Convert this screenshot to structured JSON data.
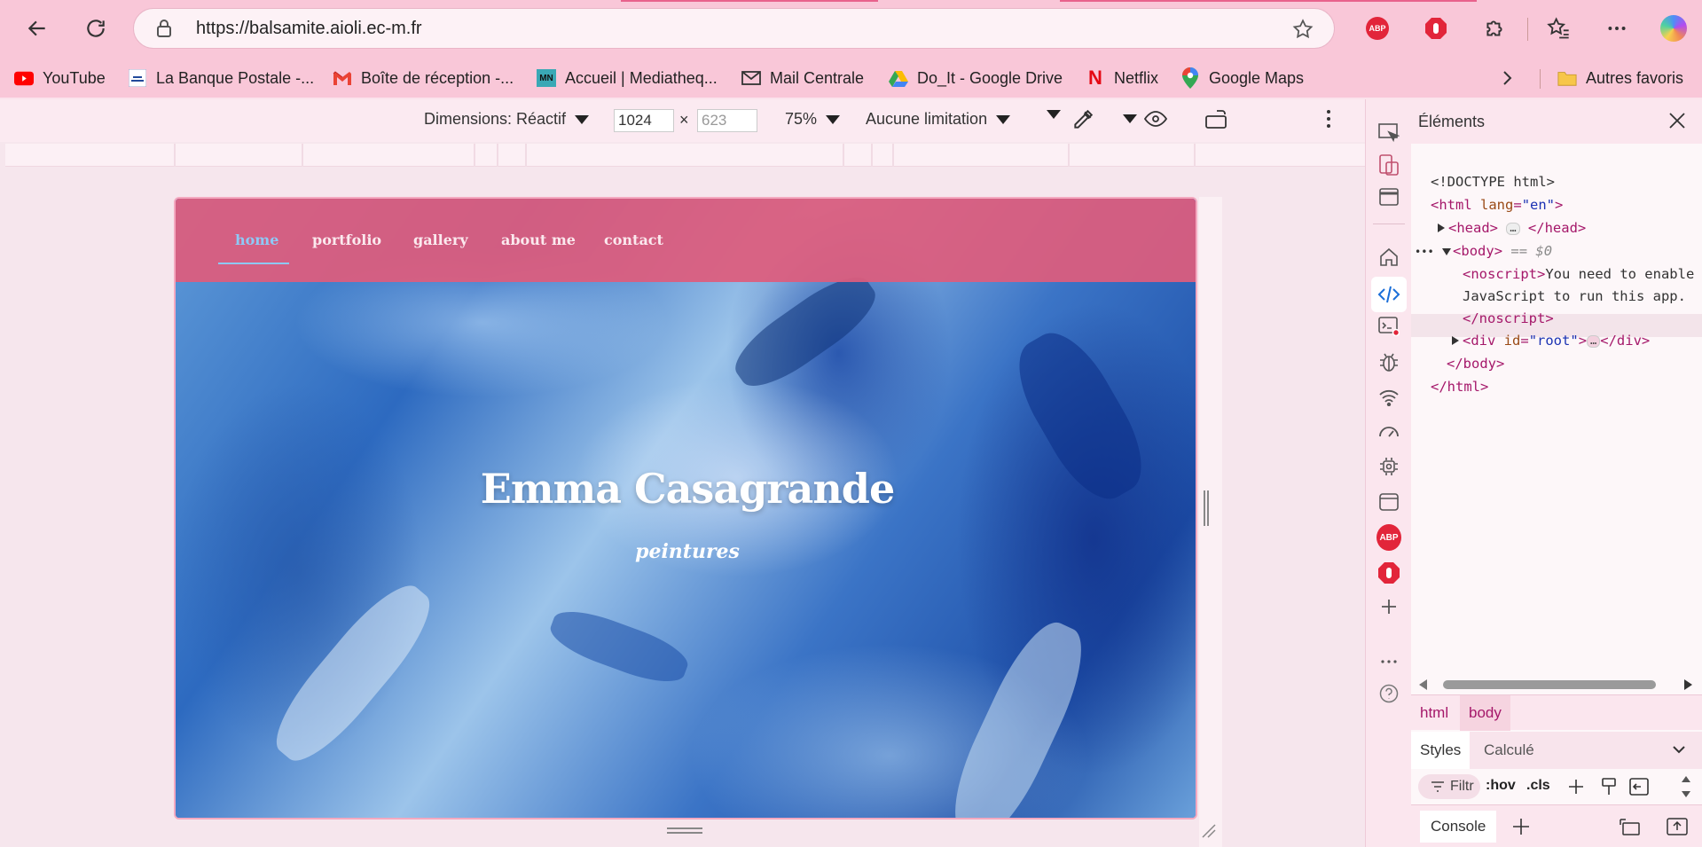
{
  "browser": {
    "url": "https://balsamite.aioli.ec-m.fr",
    "bookmarks": [
      {
        "label": "YouTube",
        "icon": "youtube-icon"
      },
      {
        "label": "La Banque Postale -...",
        "icon": "banque-postale-icon"
      },
      {
        "label": "Boîte de réception -...",
        "icon": "gmail-icon"
      },
      {
        "label": "Accueil | Mediatheq...",
        "icon": "mediatheque-icon",
        "badge": "MN"
      },
      {
        "label": "Mail Centrale",
        "icon": "mail-icon"
      },
      {
        "label": "Do_It - Google Drive",
        "icon": "google-drive-icon"
      },
      {
        "label": "Netflix",
        "icon": "netflix-icon",
        "badge": "N"
      },
      {
        "label": "Google Maps",
        "icon": "google-maps-icon"
      }
    ],
    "other_favorites": "Autres favoris",
    "abp_label": "ABP"
  },
  "emulation": {
    "dimensions_label": "Dimensions: Réactif",
    "width": "1024",
    "separator": "×",
    "height_placeholder": "623",
    "zoom": "75%",
    "throttling": "Aucune limitation"
  },
  "site": {
    "nav": [
      "home",
      "portfolio",
      "gallery",
      "about me",
      "contact"
    ],
    "active_nav": "home",
    "title": "Emma Casagrande",
    "subtitle": "peintures"
  },
  "devtools": {
    "panel_title": "Éléments",
    "dom": {
      "doctype": "<!DOCTYPE html>",
      "html_open_tag": "<html",
      "html_attr": "lang",
      "html_attr_value": "\"en\"",
      "head_open": "<head>",
      "head_close": "</head>",
      "body_open": "<body>",
      "body_marker": "== $0",
      "noscript_open": "<noscript>",
      "noscript_text_1": "You need to enable",
      "noscript_text_2": "JavaScript to run this app.",
      "noscript_close": "</noscript>",
      "div_open": "<div",
      "div_attr": "id",
      "div_attr_value": "\"root\"",
      "div_close": "</div>",
      "body_close": "</body>",
      "html_close": "</html>",
      "collapsed": "…"
    },
    "breadcrumbs": [
      "html",
      "body"
    ],
    "style_tabs": [
      "Styles",
      "Calculé"
    ],
    "filter_placeholder": "Filtr",
    "hov": ":hov",
    "cls": ".cls",
    "console_label": "Console"
  },
  "colors": {
    "chrome_pink": "#f9c7d8",
    "site_nav": "#de5c7d",
    "active_link": "#8ec9f6"
  }
}
